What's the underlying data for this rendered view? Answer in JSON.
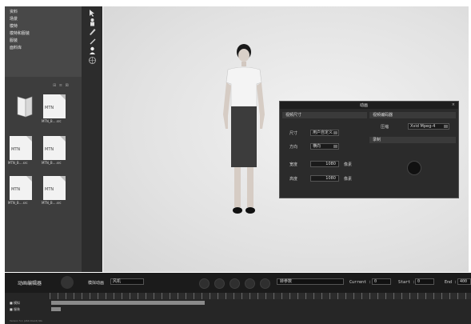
{
  "nav": {
    "items": [
      "资料",
      "场景",
      "模特",
      "模特和服装",
      "服装",
      "面料库"
    ]
  },
  "file_panel": {
    "toolbar_glyph": "⊞  ≡  ⊠",
    "files": [
      {
        "icon": "book-icon",
        "doc_text": "",
        "label": ""
      },
      {
        "icon": "document-icon",
        "doc_text": "MTN",
        "label": "MTN_B....src"
      },
      {
        "icon": "document-icon",
        "doc_text": "MTN",
        "label": "MTN_B....src"
      },
      {
        "icon": "document-icon",
        "doc_text": "MTN",
        "label": "MTN_B....src"
      },
      {
        "icon": "document-icon",
        "doc_text": "MTN",
        "label": "MTN_B....src"
      },
      {
        "icon": "document-icon",
        "doc_text": "MTN",
        "label": "MTN_B....src"
      }
    ]
  },
  "tools": [
    "cursor-icon",
    "avatar-icon",
    "brush-icon",
    "pen-icon",
    "person-icon",
    "sphere-icon"
  ],
  "dialog": {
    "title": "动画",
    "close": "×",
    "section_size": "视频尺寸",
    "section_encoder": "视频编码器",
    "section_record": "录制",
    "size_label": "尺寸",
    "size_value": "用户自定义",
    "orientation_label": "方向",
    "orientation_value": "横向",
    "width_label": "宽度",
    "width_value": "1080",
    "height_label": "高度",
    "height_value": "1080",
    "unit": "像素",
    "encoder_label": "压缩",
    "encoder_value": "Xvid Mpeg-4"
  },
  "timeline": {
    "title": "动画编辑器",
    "anim_label": "模拟动画",
    "anim_value": "风机",
    "mode_value": "转参数",
    "current_label": "Current :",
    "current_value": "0",
    "start_label": "Start :",
    "start_value": "0",
    "end_label": "End :",
    "end_value": "400",
    "tracks": [
      "■  模拟",
      "■  服装"
    ],
    "footer": "Version 5.1 (x64 Client) NG"
  },
  "colors": {
    "dialog_bg": "#2b2b2b",
    "panel_bg": "#3d3d3d",
    "viewport_bg": "#e2e2e2"
  }
}
